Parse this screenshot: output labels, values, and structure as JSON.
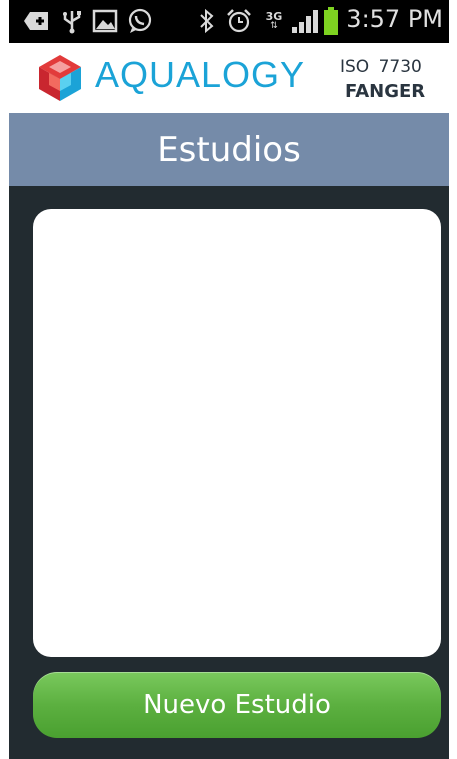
{
  "status_bar": {
    "time": "3:57 PM",
    "network_type": "3G",
    "icons": [
      "add-notification-icon",
      "usb-icon",
      "image-icon",
      "whatsapp-icon",
      "bluetooth-icon",
      "alarm-icon",
      "network-3g-icon",
      "signal-icon",
      "battery-icon"
    ]
  },
  "brand": {
    "name": "AQUALOGY",
    "standard": "ISO 7730",
    "method": "FANGER",
    "accent_color": "#1ba3d7"
  },
  "header": {
    "title": "Estudios",
    "color": "#758ba9"
  },
  "studies": {
    "items": []
  },
  "actions": {
    "new_study_label": "Nuevo Estudio",
    "button_color": "#5cb040"
  }
}
